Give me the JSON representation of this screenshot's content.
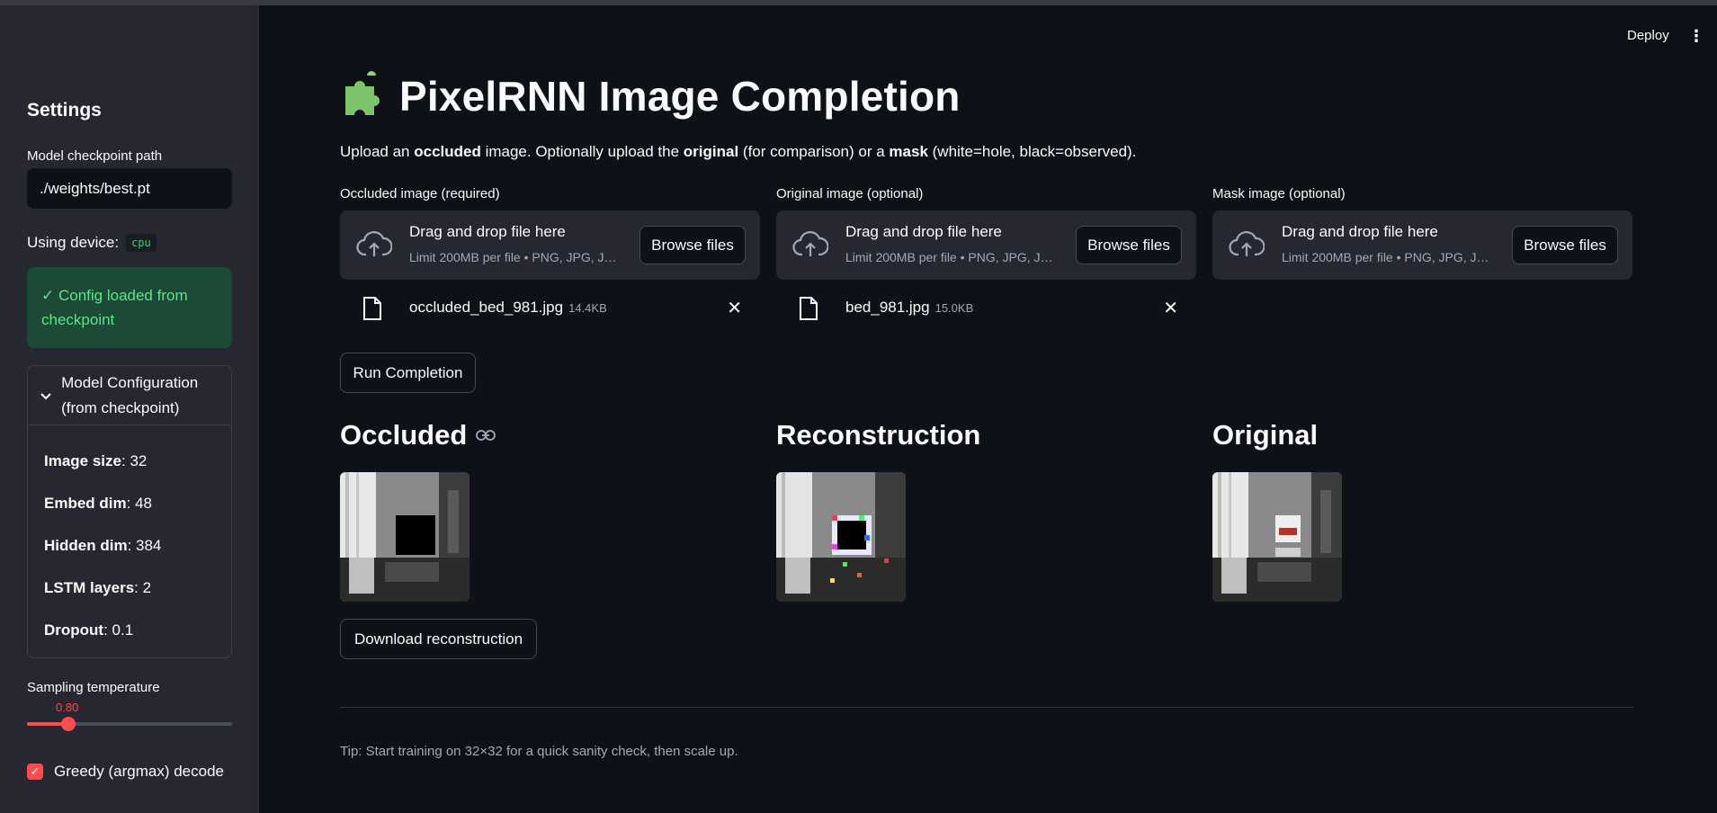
{
  "header": {
    "deploy_label": "Deploy",
    "menu_icon": "⋮"
  },
  "sidebar": {
    "title": "Settings",
    "checkpoint_label": "Model checkpoint path",
    "checkpoint_value": "./weights/best.pt",
    "device_label": "Using device:",
    "device_value": "cpu",
    "success_message": "✓ Config loaded from checkpoint",
    "expander_title": "Model Configuration (from checkpoint)",
    "config": [
      {
        "key": "Image size",
        "value": ": 32"
      },
      {
        "key": "Embed dim",
        "value": ": 48"
      },
      {
        "key": "Hidden dim",
        "value": ": 384"
      },
      {
        "key": "LSTM layers",
        "value": ": 2"
      },
      {
        "key": "Dropout",
        "value": ": 0.1"
      }
    ],
    "temperature_label": "Sampling temperature",
    "temperature_value": "0.80",
    "temperature_fraction": 0.2,
    "greedy_label": "Greedy (argmax) decode",
    "greedy_checked": true
  },
  "main": {
    "title_icon": "🧩",
    "title": "PixelRNN Image Completion",
    "intro": {
      "p1": "Upload an ",
      "b1": "occluded",
      "p2": " image. Optionally upload the ",
      "b2": "original",
      "p3": " (for comparison) or a ",
      "b3": "mask",
      "p4": " (white=hole, black=observed)."
    },
    "uploaders": [
      {
        "label": "Occluded image (required)",
        "drop_title": "Drag and drop file here",
        "drop_sub": "Limit 200MB per file • PNG, JPG, J…",
        "browse": "Browse files",
        "file_name": "occluded_bed_981.jpg",
        "file_size": "14.4KB"
      },
      {
        "label": "Original image (optional)",
        "drop_title": "Drag and drop file here",
        "drop_sub": "Limit 200MB per file • PNG, JPG, J…",
        "browse": "Browse files",
        "file_name": "bed_981.jpg",
        "file_size": "15.0KB"
      },
      {
        "label": "Mask image (optional)",
        "drop_title": "Drag and drop file here",
        "drop_sub": "Limit 200MB per file • PNG, JPG, J…",
        "browse": "Browse files"
      }
    ],
    "run_button": "Run Completion",
    "columns": [
      {
        "heading": "Occluded"
      },
      {
        "heading": "Reconstruction"
      },
      {
        "heading": "Original"
      }
    ],
    "download_button": "Download reconstruction",
    "tip": "Tip: Start training on 32×32 for a quick sanity check, then scale up.",
    "colors": {
      "accent": "#ff4b4b",
      "success_bg": "#1c4a37",
      "success_text": "#5ce488",
      "bg": "#0e1117",
      "sidebar_bg": "#262730"
    }
  }
}
